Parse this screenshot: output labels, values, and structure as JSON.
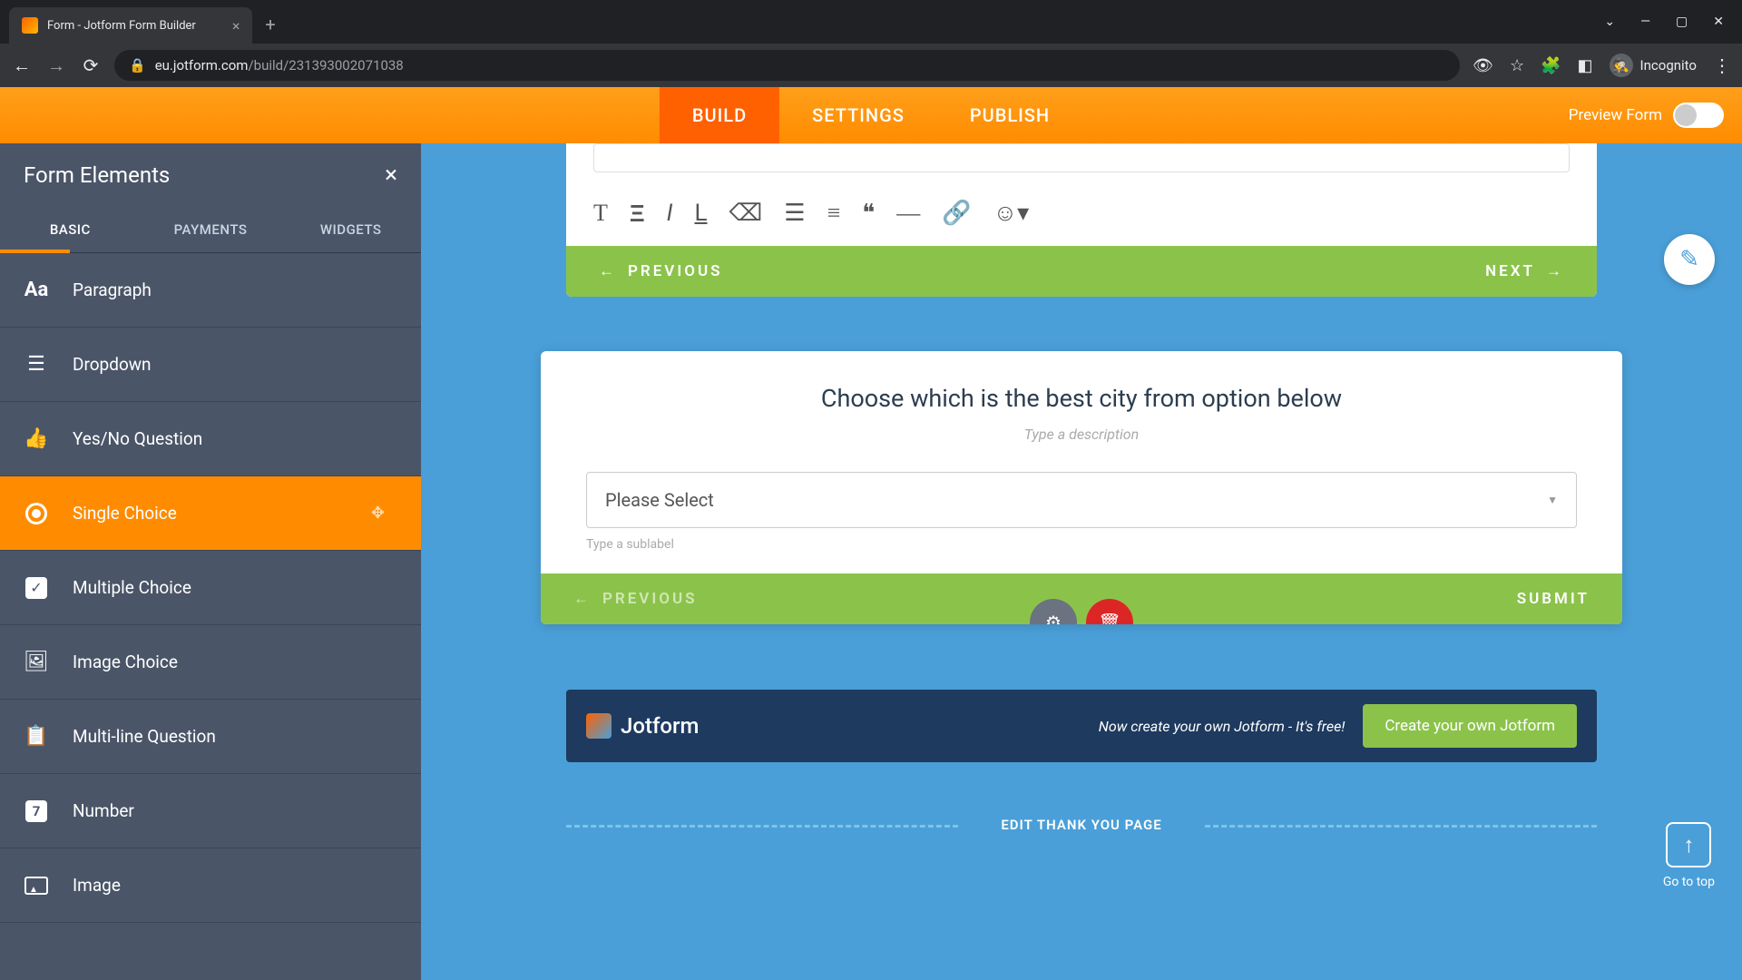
{
  "browser": {
    "tab_title": "Form - Jotform Form Builder",
    "url_domain": "eu.jotform.com",
    "url_path": "/build/231393002071038",
    "incognito_label": "Incognito"
  },
  "header": {
    "tabs": {
      "build": "BUILD",
      "settings": "SETTINGS",
      "publish": "PUBLISH"
    },
    "preview_label": "Preview Form"
  },
  "sidebar": {
    "title": "Form Elements",
    "tabs": {
      "basic": "BASIC",
      "payments": "PAYMENTS",
      "widgets": "WIDGETS"
    },
    "items": [
      {
        "label": "Paragraph",
        "icon": "Aa"
      },
      {
        "label": "Dropdown",
        "icon": "▭"
      },
      {
        "label": "Yes/No Question",
        "icon": "👍"
      },
      {
        "label": "Single Choice",
        "icon": "◉",
        "active": true
      },
      {
        "label": "Multiple Choice",
        "icon": "☑"
      },
      {
        "label": "Image Choice",
        "icon": "🖼"
      },
      {
        "label": "Multi-line Question",
        "icon": "📋"
      },
      {
        "label": "Number",
        "icon": "7"
      },
      {
        "label": "Image",
        "icon": "🖼"
      }
    ]
  },
  "card1": {
    "prev": "PREVIOUS",
    "next": "NEXT"
  },
  "card2": {
    "title": "Choose which is the best city from option below",
    "desc_placeholder": "Type a description",
    "select_placeholder": "Please Select",
    "sublabel_placeholder": "Type a sublabel",
    "prev": "PREVIOUS",
    "submit": "SUBMIT"
  },
  "banner": {
    "logo_text": "Jotform",
    "text": "Now create your own Jotform - It's free!",
    "cta": "Create your own Jotform"
  },
  "goto_top": "Go to top",
  "edit_thanks": "EDIT THANK YOU PAGE"
}
